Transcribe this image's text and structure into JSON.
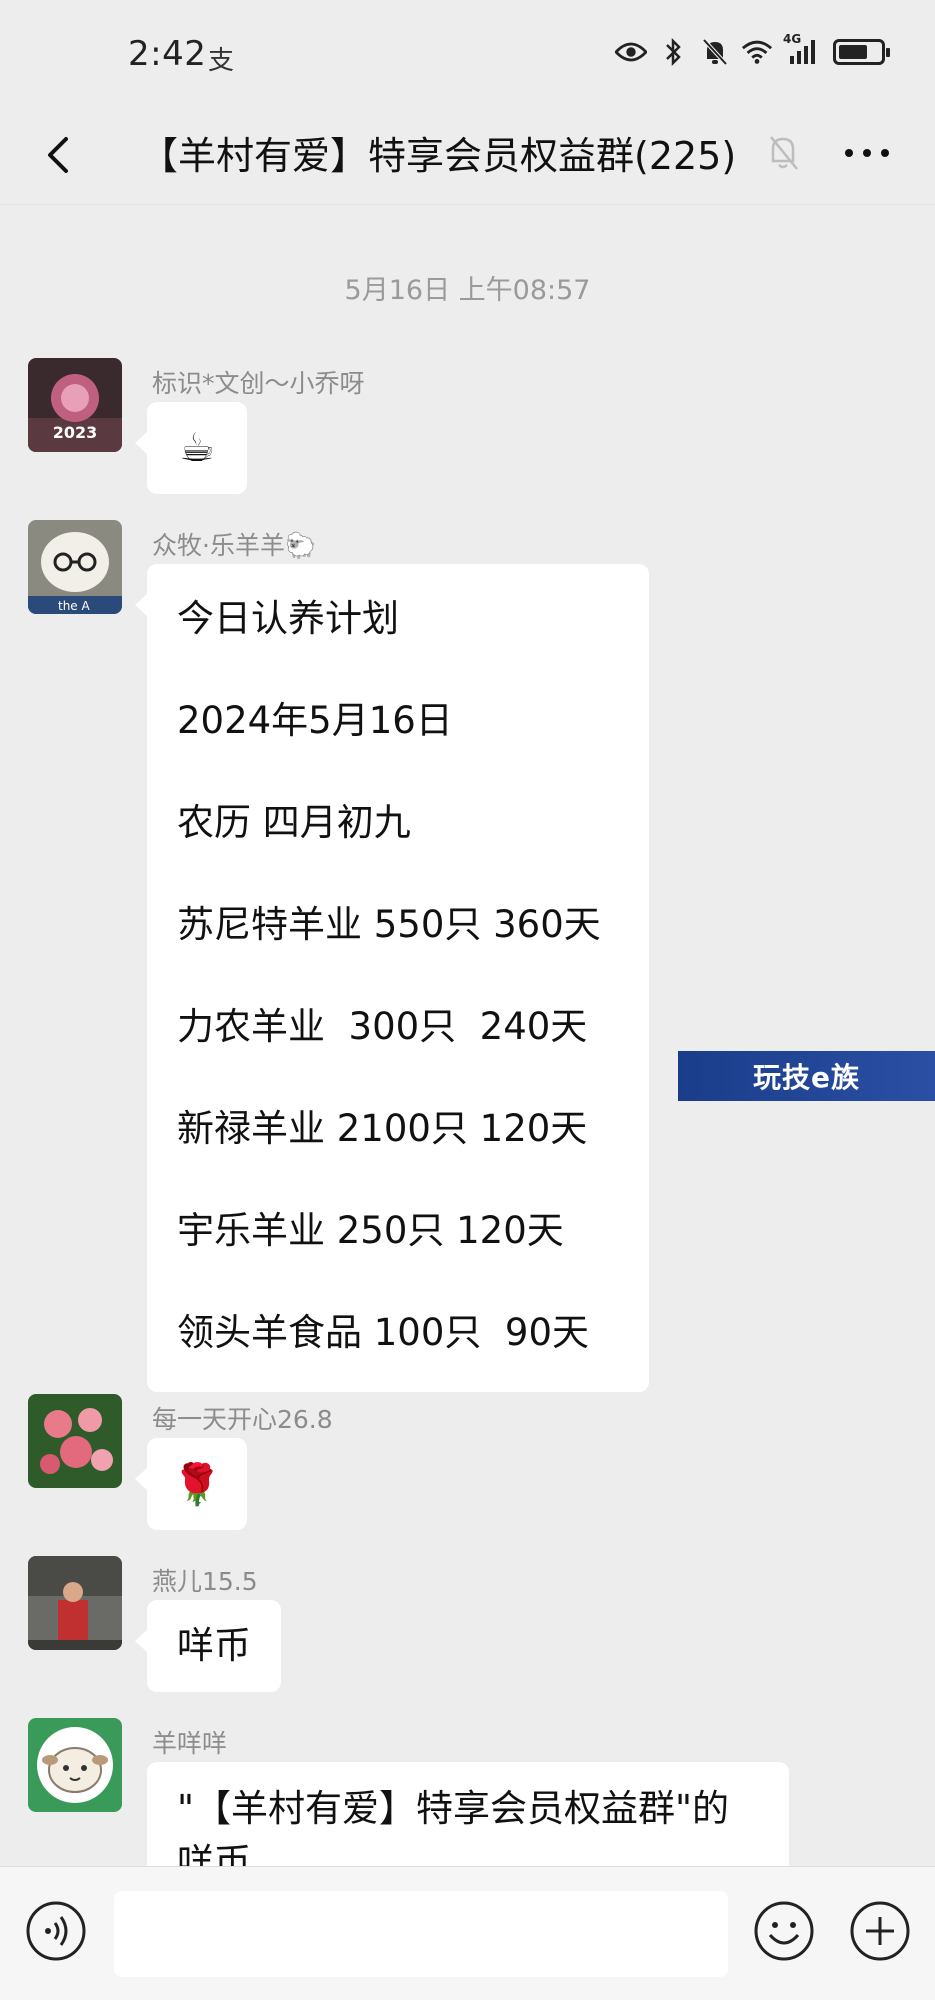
{
  "status_bar": {
    "time": "2:42",
    "extra_icon": "支",
    "icons": [
      "eye-icon",
      "bluetooth-icon",
      "bell-off-icon",
      "wifi-icon",
      "signal-icon",
      "battery-icon"
    ],
    "network": "4G",
    "battery_level": 0.7
  },
  "header": {
    "title": "【羊村有爱】特享会员权益群(225)",
    "back_icon": "back-arrow-icon",
    "mute_icon": "bell-off-icon",
    "more_icon": "more-icon"
  },
  "chat": {
    "timestamp": "5月16日 上午08:57",
    "messages": [
      {
        "sender": "标识*文创～小乔呀",
        "content": "☕",
        "kind": "emoji"
      },
      {
        "sender": "众牧·乐羊羊🐑",
        "kind": "text",
        "lines": [
          "今日认养计划",
          "2024年5月16日",
          "农历 四月初九",
          "苏尼特羊业 550只 360天",
          "力农羊业  300只  240天",
          "新禄羊业 2100只 120天",
          "宇乐羊业 250只 120天",
          "领头羊食品 100只  90天"
        ]
      },
      {
        "sender": "每一天开心26.8",
        "content": "🌹",
        "kind": "emoji"
      },
      {
        "sender": "燕儿15.5",
        "content": "咩币",
        "kind": "text"
      },
      {
        "sender": "羊咩咩",
        "kind": "text",
        "content": "\"【羊村有爱】特享会员权益群\"的",
        "content_cut": "咩币"
      }
    ]
  },
  "watermark": "玩技e族",
  "input_bar": {
    "placeholder": "",
    "voice_icon": "voice-icon",
    "emoji_icon": "emoji-icon",
    "plus_icon": "plus-icon"
  },
  "colors": {
    "background": "#ededed",
    "bubble": "#ffffff",
    "sender_text": "#8c8c8c",
    "watermark_bg": "#1a3d8a"
  }
}
